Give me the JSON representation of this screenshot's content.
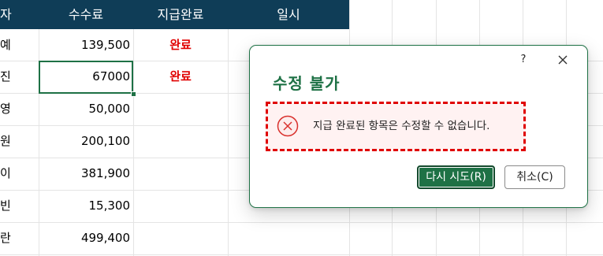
{
  "sheet": {
    "headers": [
      "자",
      "수수료",
      "지급완료",
      "일시"
    ],
    "rows": [
      {
        "name": "예",
        "fee": "139,500",
        "status": "완료"
      },
      {
        "name": "진",
        "fee": "67000",
        "status": "완료"
      },
      {
        "name": "영",
        "fee": "50,000",
        "status": ""
      },
      {
        "name": "원",
        "fee": "200,100",
        "status": ""
      },
      {
        "name": "이",
        "fee": "381,900",
        "status": ""
      },
      {
        "name": "빈",
        "fee": "15,300",
        "status": ""
      },
      {
        "name": "란",
        "fee": "499,400",
        "status": ""
      }
    ],
    "header_bg": "#0f3d57",
    "status_color": "#e00000",
    "selection_color": "#1e7145"
  },
  "dialog": {
    "help_label": "?",
    "close_icon": "close-icon",
    "title": "수정 불가",
    "title_color": "#1e7145",
    "message": "지급 완료된 항목은 수정할 수 없습니다.",
    "error_icon": "error-circle-x-icon",
    "highlight_color": "#e00000",
    "retry_button": "다시 시도(R)",
    "cancel_button": "취소(C)"
  }
}
